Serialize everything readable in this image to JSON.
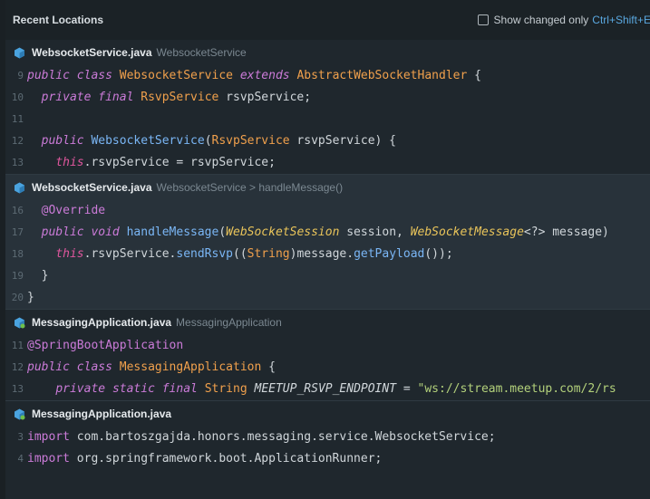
{
  "header": {
    "title": "Recent Locations",
    "option_label": "Show changed only",
    "shortcut": "Ctrl+Shift+E"
  },
  "sections": [
    {
      "file": "WebsocketService.java",
      "context": "WebsocketService",
      "selected": false,
      "lines": [
        {
          "num": "9",
          "tokens": [
            [
              "kw",
              "public"
            ],
            [
              "p",
              " "
            ],
            [
              "kw",
              "class"
            ],
            [
              "p",
              " "
            ],
            [
              "cls",
              "WebsocketService"
            ],
            [
              "p",
              " "
            ],
            [
              "kw",
              "extends"
            ],
            [
              "p",
              " "
            ],
            [
              "cls",
              "AbstractWebSocketHandler"
            ],
            [
              "p",
              " {"
            ]
          ]
        },
        {
          "num": "10",
          "tokens": [
            [
              "p",
              "  "
            ],
            [
              "kw",
              "private"
            ],
            [
              "p",
              " "
            ],
            [
              "kw",
              "final"
            ],
            [
              "p",
              " "
            ],
            [
              "cls",
              "RsvpService"
            ],
            [
              "p",
              " rsvpService;"
            ]
          ]
        },
        {
          "num": "11",
          "tokens": []
        },
        {
          "num": "12",
          "tokens": [
            [
              "p",
              "  "
            ],
            [
              "kw",
              "public"
            ],
            [
              "p",
              " "
            ],
            [
              "fn",
              "WebsocketService"
            ],
            [
              "p",
              "("
            ],
            [
              "cls",
              "RsvpService"
            ],
            [
              "p",
              " rsvpService) {"
            ]
          ]
        },
        {
          "num": "13",
          "tokens": [
            [
              "p",
              "    "
            ],
            [
              "this",
              "this"
            ],
            [
              "p",
              ".rsvpService = rsvpService;"
            ]
          ]
        }
      ]
    },
    {
      "file": "WebsocketService.java",
      "context": "WebsocketService > handleMessage()",
      "selected": true,
      "lines": [
        {
          "num": "16",
          "tokens": [
            [
              "p",
              "  "
            ],
            [
              "ann",
              "@Override"
            ]
          ]
        },
        {
          "num": "17",
          "tokens": [
            [
              "p",
              "  "
            ],
            [
              "kw",
              "public"
            ],
            [
              "p",
              " "
            ],
            [
              "kw",
              "void"
            ],
            [
              "p",
              " "
            ],
            [
              "fn",
              "handleMessage"
            ],
            [
              "p",
              "("
            ],
            [
              "clsi",
              "WebSocketSession"
            ],
            [
              "p",
              " session, "
            ],
            [
              "clsi",
              "WebSocketMessage"
            ],
            [
              "p",
              "<?> message)"
            ]
          ]
        },
        {
          "num": "18",
          "tokens": [
            [
              "p",
              "    "
            ],
            [
              "this",
              "this"
            ],
            [
              "p",
              ".rsvpService."
            ],
            [
              "fn",
              "sendRsvp"
            ],
            [
              "p",
              "(("
            ],
            [
              "cls",
              "String"
            ],
            [
              "p",
              ")message."
            ],
            [
              "fn",
              "getPayload"
            ],
            [
              "p",
              "());"
            ]
          ]
        },
        {
          "num": "19",
          "tokens": [
            [
              "p",
              "  }"
            ]
          ]
        },
        {
          "num": "20",
          "tokens": [
            [
              "p",
              "}"
            ]
          ]
        }
      ]
    },
    {
      "file": "MessagingApplication.java",
      "context": "MessagingApplication",
      "selected": false,
      "lines": [
        {
          "num": "11",
          "tokens": [
            [
              "ann",
              "@SpringBootApplication"
            ]
          ]
        },
        {
          "num": "12",
          "tokens": [
            [
              "kw",
              "public"
            ],
            [
              "p",
              " "
            ],
            [
              "kw",
              "class"
            ],
            [
              "p",
              " "
            ],
            [
              "cls",
              "MessagingApplication"
            ],
            [
              "p",
              " {"
            ]
          ]
        },
        {
          "num": "13",
          "tokens": [
            [
              "p",
              "    "
            ],
            [
              "kw",
              "private"
            ],
            [
              "p",
              " "
            ],
            [
              "kw",
              "static"
            ],
            [
              "p",
              " "
            ],
            [
              "kw",
              "final"
            ],
            [
              "p",
              " "
            ],
            [
              "cls",
              "String"
            ],
            [
              "p",
              " "
            ],
            [
              "it",
              "MEETUP_RSVP_ENDPOINT"
            ],
            [
              "p",
              " = "
            ],
            [
              "str",
              "\"ws://stream.meetup.com/2/rs"
            ]
          ]
        }
      ]
    },
    {
      "file": "MessagingApplication.java",
      "context": "",
      "selected": false,
      "lines": [
        {
          "num": "3",
          "tokens": [
            [
              "kw-n",
              "import"
            ],
            [
              "p",
              " com.bartoszgajda.honors.messaging.service.WebsocketService;"
            ]
          ]
        },
        {
          "num": "4",
          "tokens": [
            [
              "kw-n",
              "import"
            ],
            [
              "p",
              " org.springframework.boot.ApplicationRunner;"
            ]
          ]
        }
      ]
    }
  ]
}
